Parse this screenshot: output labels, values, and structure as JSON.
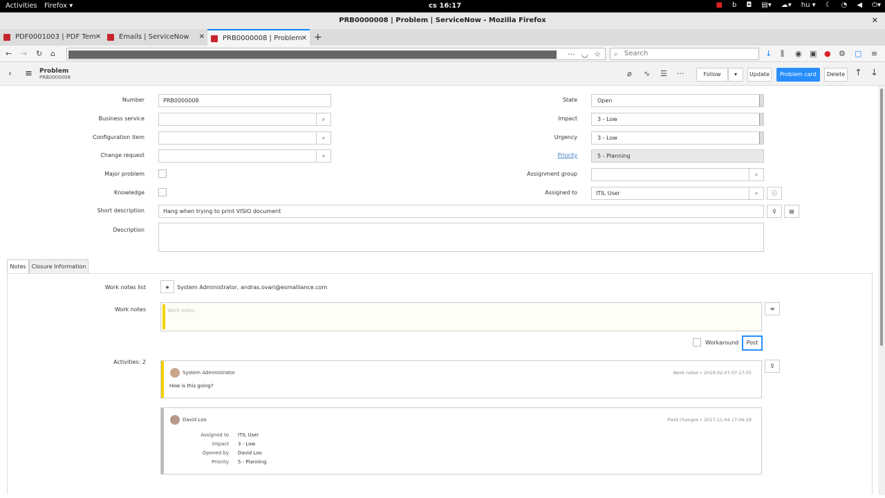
{
  "gnome": {
    "activities": "Activities",
    "app": "Firefox ▾",
    "clock": "cs 16:17",
    "lang": "hu ▾"
  },
  "window": {
    "title": "PRB0000008 | Problem | ServiceNow - Mozilla Firefox"
  },
  "tabs": [
    {
      "label": "PDF0001003 | PDF Tem"
    },
    {
      "label": "Emails | ServiceNow"
    },
    {
      "label": "PRB0000008 | Problem"
    }
  ],
  "search": {
    "placeholder": "Search"
  },
  "header": {
    "title": "Problem",
    "subtitle": "PRB0000008",
    "follow": "Follow",
    "update": "Update",
    "problem_card": "Problem card",
    "delete": "Delete"
  },
  "form": {
    "number_label": "Number",
    "number": "PRB0000008",
    "business_service_label": "Business service",
    "configuration_item_label": "Configuration item",
    "change_request_label": "Change request",
    "major_problem_label": "Major problem",
    "knowledge_label": "Knowledge",
    "short_description_label": "Short description",
    "short_description": "Hang when trying to print VISIO document",
    "description_label": "Description",
    "state_label": "State",
    "state": "Open",
    "impact_label": "Impact",
    "impact": "3 - Low",
    "urgency_label": "Urgency",
    "urgency": "3 - Low",
    "priority_label": "Priority",
    "priority": "5 - Planning",
    "assignment_group_label": "Assignment group",
    "assigned_to_label": "Assigned to",
    "assigned_to": "ITIL User"
  },
  "form_tabs": {
    "notes": "Notes",
    "closure": "Closure Information"
  },
  "notes": {
    "work_notes_list_label": "Work notes list",
    "work_notes_list": "System Administrator, andras.ovari@esmalliance.com",
    "work_notes_label": "Work notes",
    "work_notes_placeholder": "Work notes",
    "workaround_label": "Workaround",
    "post": "Post",
    "activities_label": "Activities: 2"
  },
  "activities": [
    {
      "author": "System Administrator",
      "meta": "Work notes  •  2019-02-07 07:17:55",
      "text": "How is this going?"
    },
    {
      "author": "David Loo",
      "meta": "Field changes  •  2017-11-04 17:06:28",
      "fields": [
        {
          "k": "Assigned to",
          "v": "ITIL User"
        },
        {
          "k": "Impact",
          "v": "3 - Low"
        },
        {
          "k": "Opened by",
          "v": "David Loo"
        },
        {
          "k": "Priority",
          "v": "5 - Planning"
        }
      ]
    }
  ],
  "colors": {
    "accent": "#278efc",
    "worknote_bar": "#f5d100"
  }
}
